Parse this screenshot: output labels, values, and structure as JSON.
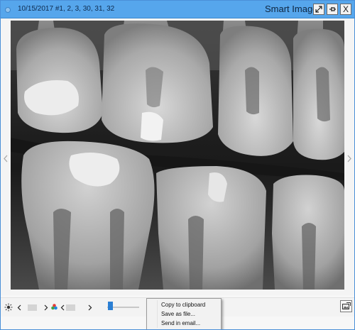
{
  "window": {
    "title": "Smart Image",
    "exam_label": "10/15/2017 #1, 2, 3, 30, 31, 32",
    "buttons": {
      "expand_icon": "expand-icon",
      "pin_icon": "pin-icon",
      "close_label": "X"
    }
  },
  "viewer": {
    "image_description_icon": "dental-xray-bitewing",
    "prev_icon": "chevron-left-icon",
    "next_icon": "chevron-right-icon"
  },
  "toolbar": {
    "brightness_icon": "brightness-icon",
    "color_icon": "color-palette-icon",
    "zoom_level_fraction": 0.1,
    "export_icon": "image-export-icon"
  },
  "context_menu": {
    "items": [
      "Copy to clipboard",
      "Save as file...",
      "Send in email..."
    ]
  },
  "colors": {
    "titlebar": "#56a6ec",
    "accent": "#2b7fd4"
  }
}
